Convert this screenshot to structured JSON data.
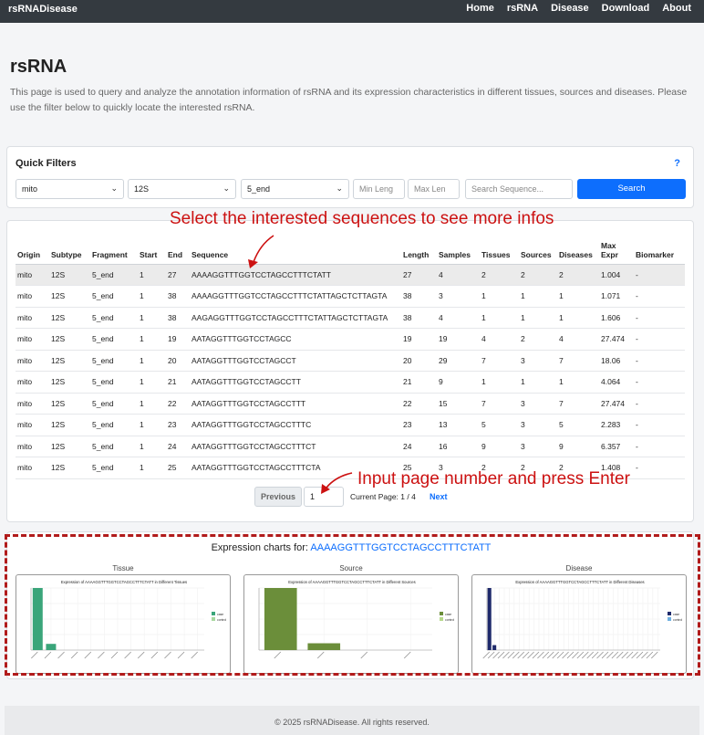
{
  "nav": {
    "brand": "rsRNADisease",
    "links": [
      "Home",
      "rsRNA",
      "Disease",
      "Download",
      "About"
    ]
  },
  "page": {
    "title": "rsRNA",
    "description": "This page is used to query and analyze the annotation information of rsRNA and its expression characteristics in different tissues, sources and diseases. Please use the filter below to quickly locate the interested rsRNA."
  },
  "filters": {
    "title": "Quick Filters",
    "help": "?",
    "origin": "mito",
    "subtype": "12S",
    "fragment": "5_end",
    "min_length_placeholder": "Min Leng",
    "max_length_placeholder": "Max Len",
    "sequence_placeholder": "Search Sequence...",
    "search_label": "Search"
  },
  "table": {
    "headers": [
      "Origin",
      "Subtype",
      "Fragment",
      "Start",
      "End",
      "Sequence",
      "Length",
      "Samples",
      "Tissues",
      "Sources",
      "Diseases",
      "Max Expr",
      "Biomarker"
    ],
    "rows": [
      [
        "mito",
        "12S",
        "5_end",
        "1",
        "27",
        "AAAAGGTTTGGTCCTAGCCTTTCTATT",
        "27",
        "4",
        "2",
        "2",
        "2",
        "1.004",
        "-"
      ],
      [
        "mito",
        "12S",
        "5_end",
        "1",
        "38",
        "AAAAGGTTTGGTCCTAGCCTTTCTATTAGCTCTTAGTA",
        "38",
        "3",
        "1",
        "1",
        "1",
        "1.071",
        "-"
      ],
      [
        "mito",
        "12S",
        "5_end",
        "1",
        "38",
        "AAGAGGTTTGGTCCTAGCCTTTCTATTAGCTCTTAGTA",
        "38",
        "4",
        "1",
        "1",
        "1",
        "1.606",
        "-"
      ],
      [
        "mito",
        "12S",
        "5_end",
        "1",
        "19",
        "AATAGGTTTGGTCCTAGCC",
        "19",
        "19",
        "4",
        "2",
        "4",
        "27.474",
        "-"
      ],
      [
        "mito",
        "12S",
        "5_end",
        "1",
        "20",
        "AATAGGTTTGGTCCTAGCCT",
        "20",
        "29",
        "7",
        "3",
        "7",
        "18.06",
        "-"
      ],
      [
        "mito",
        "12S",
        "5_end",
        "1",
        "21",
        "AATAGGTTTGGTCCTAGCCTT",
        "21",
        "9",
        "1",
        "1",
        "1",
        "4.064",
        "-"
      ],
      [
        "mito",
        "12S",
        "5_end",
        "1",
        "22",
        "AATAGGTTTGGTCCTAGCCTTT",
        "22",
        "15",
        "7",
        "3",
        "7",
        "27.474",
        "-"
      ],
      [
        "mito",
        "12S",
        "5_end",
        "1",
        "23",
        "AATAGGTTTGGTCCTAGCCTTTC",
        "23",
        "13",
        "5",
        "3",
        "5",
        "2.283",
        "-"
      ],
      [
        "mito",
        "12S",
        "5_end",
        "1",
        "24",
        "AATAGGTTTGGTCCTAGCCTTTCT",
        "24",
        "16",
        "9",
        "3",
        "9",
        "6.357",
        "-"
      ],
      [
        "mito",
        "12S",
        "5_end",
        "1",
        "25",
        "AATAGGTTTGGTCCTAGCCTTTCTA",
        "25",
        "3",
        "2",
        "2",
        "2",
        "1.408",
        "-"
      ]
    ]
  },
  "pagination": {
    "prev_label": "Previous",
    "page_value": "1",
    "current_page_text": "Current Page: 1 / 4",
    "next_label": "Next"
  },
  "annotations": {
    "select_hint": "Select the interested sequences to see more infos",
    "page_hint": "Input page number and press Enter"
  },
  "charts": {
    "heading_prefix": "Expression charts for:",
    "sequence": "AAAAGGTTTGGTCCTAGCCTTTCTATT",
    "panels": [
      {
        "label": "Tissue",
        "title": "Expression of AAAAGGTTTGGTCCTAGCCTTTCTATT in Different Tissues",
        "legend": [
          "case",
          "control"
        ],
        "colors": [
          "#3aa57a",
          "#a8d8a0"
        ],
        "values": [
          1.0,
          0.1,
          0,
          0,
          0,
          0,
          0,
          0,
          0,
          0,
          0,
          0,
          0
        ]
      },
      {
        "label": "Source",
        "title": "Expression of AAAAGGTTTGGTCCTAGCCTTTCTATT in Different Sources",
        "legend": [
          "case",
          "control"
        ],
        "colors": [
          "#6b8e3a",
          "#b5d88a"
        ],
        "values": [
          1.0,
          0.11,
          0,
          0
        ]
      },
      {
        "label": "Disease",
        "title": "Expression of AAAAGGTTTGGTCCTAGCCTTTCTATT in Different Diseases",
        "legend": [
          "case",
          "control"
        ],
        "colors": [
          "#1f2a6b",
          "#6fb0e0"
        ],
        "values": [
          1.0,
          0.08,
          0,
          0,
          0,
          0,
          0,
          0,
          0,
          0,
          0,
          0,
          0,
          0,
          0,
          0,
          0,
          0,
          0,
          0,
          0,
          0,
          0,
          0,
          0,
          0,
          0,
          0,
          0,
          0,
          0,
          0,
          0,
          0,
          0
        ]
      }
    ]
  },
  "footer": "© 2025 rsRNADisease. All rights reserved."
}
